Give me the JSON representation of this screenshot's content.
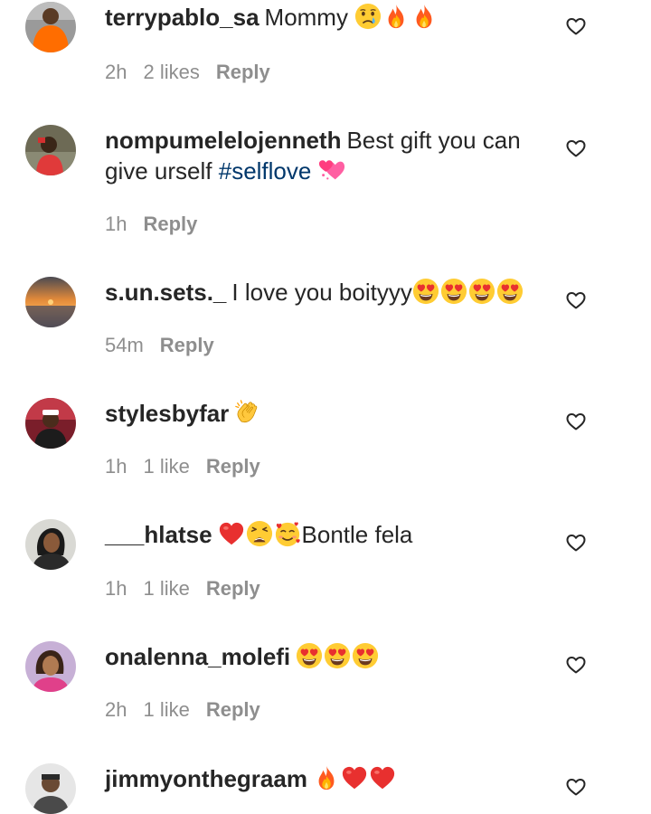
{
  "comments": [
    {
      "username": "terrypablo_sa",
      "text": "Mommy",
      "emojis": [
        "crying-face",
        "fire",
        "fire"
      ],
      "time": "2h",
      "likes": "2 likes",
      "reply": "Reply"
    },
    {
      "username": "nompumelelojenneth",
      "text": "Best gift you can give urself",
      "hashtag": "#selflove",
      "emojis": [
        "two-hearts"
      ],
      "time": "1h",
      "likes": "",
      "reply": "Reply"
    },
    {
      "username": "s.un.sets._",
      "text": "I love you boityyy",
      "emojis": [
        "heart-eyes",
        "heart-eyes",
        "heart-eyes",
        "heart-eyes"
      ],
      "time": "54m",
      "likes": "",
      "reply": "Reply"
    },
    {
      "username": "stylesbyfar",
      "text": "",
      "emojis": [
        "clapping-hands"
      ],
      "time": "1h",
      "likes": "1 like",
      "reply": "Reply"
    },
    {
      "username": "___hlatse",
      "text_after_emojis": "Bontle fela",
      "emojis": [
        "red-heart",
        "weary-face",
        "smiling-face-with-hearts"
      ],
      "time": "1h",
      "likes": "1 like",
      "reply": "Reply"
    },
    {
      "username": "onalenna_molefi",
      "text": "",
      "emojis": [
        "heart-eyes",
        "heart-eyes",
        "heart-eyes"
      ],
      "time": "2h",
      "likes": "1 like",
      "reply": "Reply"
    },
    {
      "username": "jimmyonthegraam",
      "text": "",
      "emojis": [
        "fire",
        "red-heart",
        "red-heart"
      ],
      "time": "",
      "likes": "",
      "reply": ""
    }
  ],
  "icons": {
    "like": "heart-outline-icon"
  },
  "colors": {
    "text": "#262626",
    "meta": "#8e8e8e",
    "hashtag": "#00376b",
    "heart_emoji": "#e8302f",
    "fire_emoji": "#ff6a00",
    "face_emoji": "#ffcc33"
  }
}
